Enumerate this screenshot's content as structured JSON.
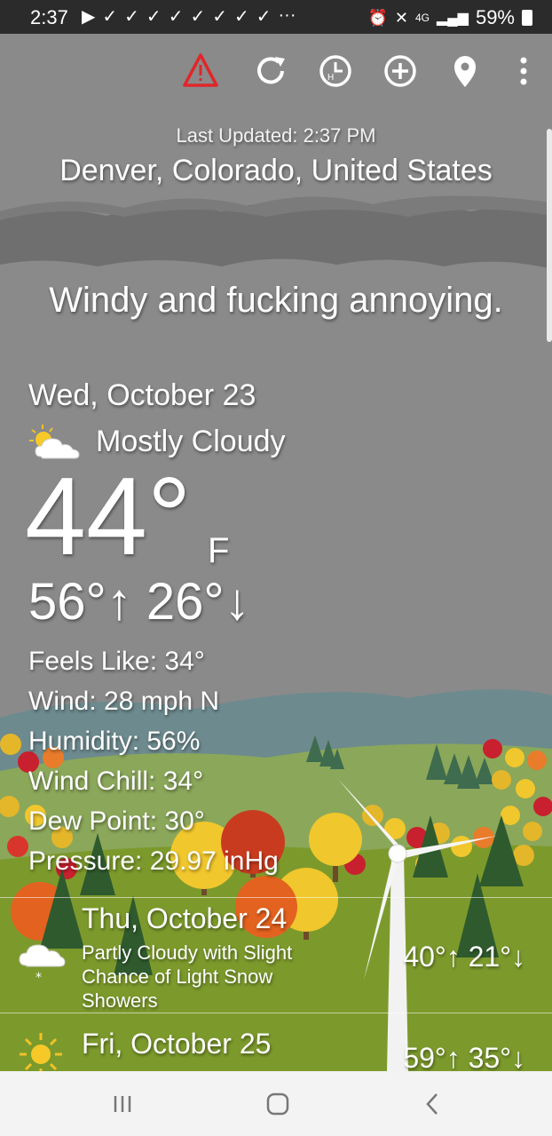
{
  "status_bar": {
    "time": "2:37",
    "network": "4G",
    "battery": "59%"
  },
  "toolbar": {
    "icons": [
      "alert-icon",
      "refresh-icon",
      "history-icon",
      "add-icon",
      "location-icon",
      "more-icon"
    ]
  },
  "header": {
    "last_updated": "Last Updated: 2:37 PM",
    "location": "Denver, Colorado, United States",
    "headline": "Windy and fucking annoying."
  },
  "current": {
    "date": "Wed, October 23",
    "condition": "Mostly Cloudy",
    "temperature": "44°",
    "unit": "F",
    "high": "56°",
    "low": "26°",
    "details": [
      "Feels Like: 34°",
      "Wind: 28 mph N",
      "Humidity: 56%",
      "Wind Chill: 34°",
      "Dew Point: 30°",
      "Pressure: 29.97 inHg"
    ]
  },
  "forecast": [
    {
      "date": "Thu, October 24",
      "condition": "Partly Cloudy with Slight Chance of Light Snow Showers",
      "high": "40°",
      "low": "21°"
    },
    {
      "date": "Fri, October 25",
      "condition": "",
      "high": "59°",
      "low": "35°"
    }
  ],
  "colors": {
    "alert": "#e0262a",
    "sky": "#8a8a8a",
    "cloud_band": "#6f6f6f",
    "hills_far": "#6d8a8e",
    "grass": "#7c9a2c",
    "nav_bar": "#f3f3f3"
  }
}
